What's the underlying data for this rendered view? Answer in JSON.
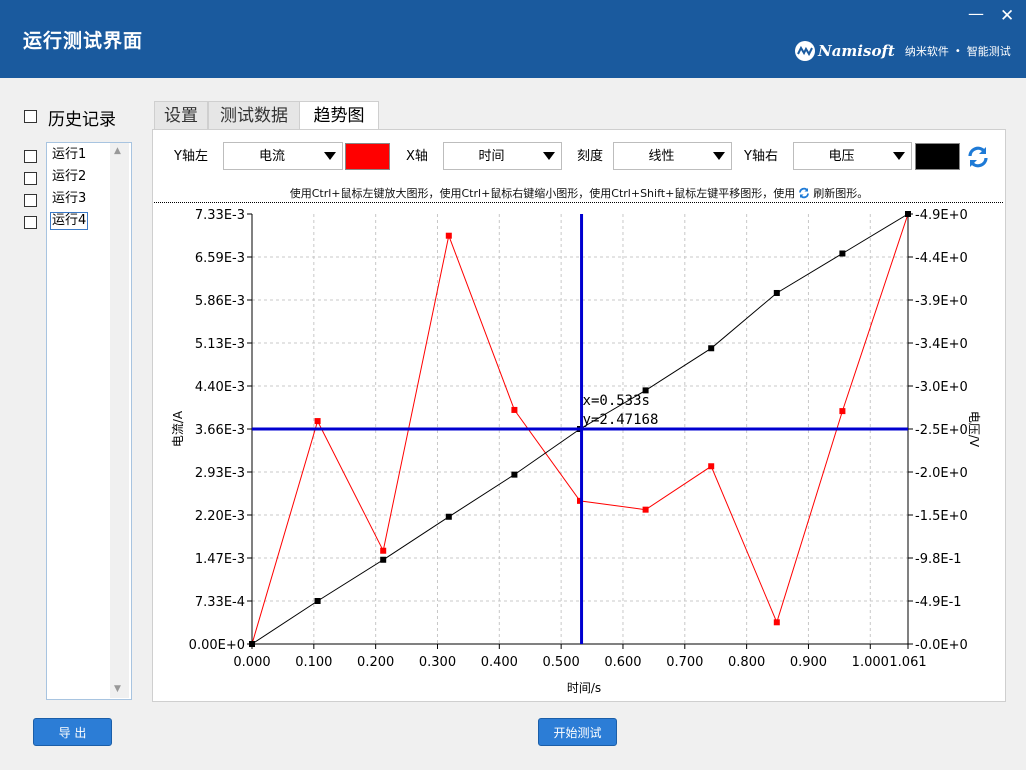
{
  "window": {
    "title": "运行测试界面",
    "minimize_label": "—",
    "close_label": "✕",
    "brand_name": "Namisoft",
    "brand_sub1": "纳米软件",
    "brand_dot": "•",
    "brand_sub2": "智能测试"
  },
  "history": {
    "label": "历史记录",
    "runs": [
      "运行1",
      "运行2",
      "运行3",
      "运行4"
    ]
  },
  "tabs": [
    {
      "label": "设置"
    },
    {
      "label": "测试数据"
    },
    {
      "label": "趋势图"
    }
  ],
  "controls": {
    "y_left_label": "Y轴左",
    "y_left_value": "电流",
    "y_left_color": "#ff0000",
    "x_label": "X轴",
    "x_value": "时间",
    "scale_label": "刻度",
    "scale_value": "线性",
    "y_right_label": "Y轴右",
    "y_right_value": "电压",
    "y_right_color": "#000000",
    "refresh_icon": "refresh-icon"
  },
  "hint": {
    "text_before": "使用Ctrl+鼠标左键放大图形，使用Ctrl+鼠标右键缩小图形，使用Ctrl+Shift+鼠标左键平移图形，使用",
    "text_after": "刷新图形。"
  },
  "chart_data": {
    "type": "line",
    "xlabel": "时间/s",
    "ylabel_left": "电流/A",
    "ylabel_right": "电压/V",
    "xlim": [
      0,
      1.061
    ],
    "ylim_left": [
      0,
      0.00733
    ],
    "ylim_right": [
      0,
      4.9
    ],
    "grid": true,
    "x_ticks": [
      "0.000",
      "0.100",
      "0.200",
      "0.300",
      "0.400",
      "0.500",
      "0.600",
      "0.700",
      "0.800",
      "0.900",
      "1.000",
      "1.061"
    ],
    "x_tick_values": [
      0,
      0.1,
      0.2,
      0.3,
      0.4,
      0.5,
      0.6,
      0.7,
      0.8,
      0.9,
      1.0,
      1.061
    ],
    "y_left_ticks": [
      "7.33E-3",
      "6.59E-3",
      "5.86E-3",
      "5.13E-3",
      "4.40E-3",
      "3.66E-3",
      "2.93E-3",
      "2.20E-3",
      "1.47E-3",
      "7.33E-4",
      "0.00E+0"
    ],
    "y_right_ticks": [
      "-4.9E+0",
      "-4.4E+0",
      "-3.9E+0",
      "-3.4E+0",
      "-3.0E+0",
      "-2.5E+0",
      "-2.0E+0",
      "-1.5E+0",
      "-9.8E-1",
      "-4.9E-1",
      "-0.0E+0"
    ],
    "series": [
      {
        "axis": "left",
        "color": "#ff0000",
        "x": [
          0,
          0.1061,
          0.2122,
          0.3183,
          0.4244,
          0.5305,
          0.6366,
          0.7427,
          0.8488,
          0.9549,
          1.061
        ],
        "y": [
          0.0,
          0.0038,
          0.00159,
          0.00696,
          0.00399,
          0.00244,
          0.00229,
          0.00303,
          0.00037,
          0.00397,
          0.00733
        ]
      },
      {
        "axis": "right",
        "color": "#000000",
        "x": [
          0,
          0.1061,
          0.2122,
          0.3183,
          0.4244,
          0.5305,
          0.6366,
          0.7427,
          0.8488,
          0.9549,
          1.061
        ],
        "y": [
          0.0,
          0.49,
          0.96,
          1.45,
          1.93,
          2.45,
          2.89,
          3.37,
          4.0,
          4.45,
          4.9
        ]
      }
    ],
    "cursor": {
      "x": 0.533,
      "y_left": 0.003664,
      "color": "#0000d0",
      "label_x": "x=0.533s",
      "label_y": "y=2.47168"
    }
  },
  "buttons": {
    "export_label": "导  出",
    "start_label": "开始测试"
  }
}
